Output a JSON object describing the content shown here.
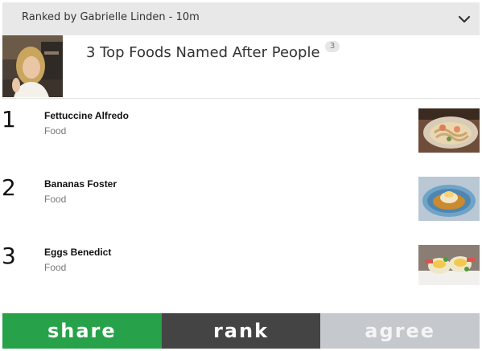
{
  "header": {
    "ranked_by": "Ranked by Gabrielle Linden - 10m",
    "toggle_icon": "chevron-down-icon"
  },
  "list": {
    "title": "3 Top Foods Named After People",
    "count": "3"
  },
  "items": [
    {
      "rank": "1",
      "name": "Fettuccine Alfredo",
      "category": "Food"
    },
    {
      "rank": "2",
      "name": "Bananas Foster",
      "category": "Food"
    },
    {
      "rank": "3",
      "name": "Eggs Benedict",
      "category": "Food"
    }
  ],
  "actions": {
    "share": "share",
    "rank": "rank",
    "agree": "agree"
  },
  "colors": {
    "share": "#27a24a",
    "rank": "#444444",
    "agree": "#c5c8cc",
    "header_bg": "#e8e8e8"
  }
}
